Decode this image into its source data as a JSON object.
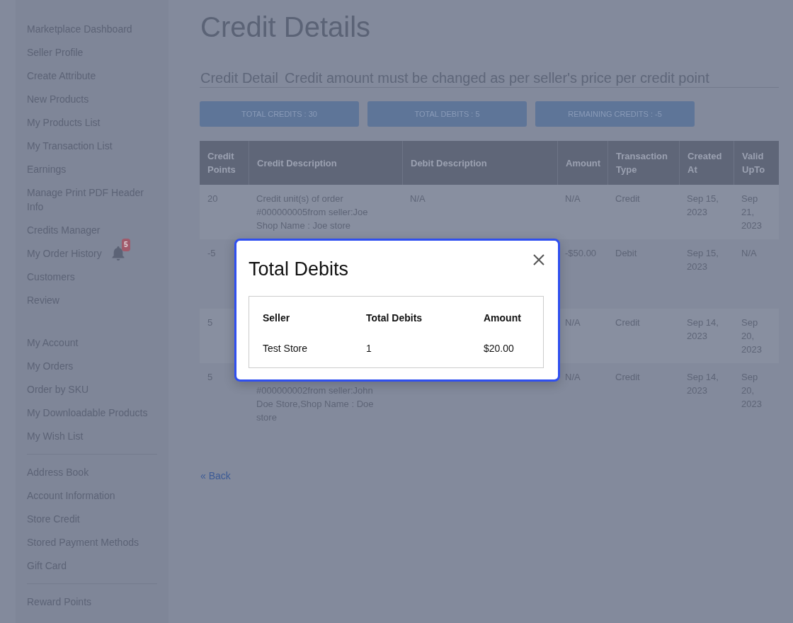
{
  "sidebar": {
    "blocks": [
      {
        "sections": [
          {
            "items": [
              {
                "label": "Marketplace Dashboard"
              },
              {
                "label": "Seller Profile"
              },
              {
                "label": "Create Attribute"
              },
              {
                "label": "New Products"
              },
              {
                "label": "My Products List"
              },
              {
                "label": "My Transaction List"
              },
              {
                "label": "Earnings"
              },
              {
                "label": "Manage Print PDF Header Info"
              },
              {
                "label": "Credits Manager"
              },
              {
                "label": "My Order History",
                "notification_count": "5"
              },
              {
                "label": "Customers"
              },
              {
                "label": "Review"
              }
            ]
          }
        ]
      },
      {
        "sections": [
          {
            "items": [
              {
                "label": "My Account"
              },
              {
                "label": "My Orders"
              },
              {
                "label": "Order by SKU"
              },
              {
                "label": "My Downloadable Products"
              },
              {
                "label": "My Wish List"
              }
            ]
          },
          {
            "items": [
              {
                "label": "Address Book"
              },
              {
                "label": "Account Information"
              },
              {
                "label": "Store Credit"
              },
              {
                "label": "Stored Payment Methods"
              },
              {
                "label": "Gift Card"
              }
            ]
          },
          {
            "items": [
              {
                "label": "Reward Points"
              }
            ]
          }
        ]
      }
    ]
  },
  "page_title": "Credit Details",
  "section": {
    "title": "Credit Detail",
    "note": "Credit amount must be changed as per seller's price per credit point"
  },
  "summary_buttons": [
    {
      "label": "TOTAL CREDITS : 30"
    },
    {
      "label": "TOTAL DEBITS : 5"
    },
    {
      "label": "REMAINING CREDITS : -5"
    }
  ],
  "table": {
    "columns": [
      "Credit Points",
      "Credit Description",
      "Debit Description",
      "Amount",
      "Transaction Type",
      "Created At",
      "Valid UpTo"
    ],
    "rows": [
      [
        "20",
        "Credit unit(s) of order #000000005from seller:Joe Shop Name : Joe store",
        "N/A",
        "N/A",
        "Credit",
        "Sep 15, 2023",
        "Sep 21, 2023"
      ],
      [
        "-5",
        null,
        null,
        "-$50.00",
        "Debit",
        "Sep 15, 2023",
        "N/A"
      ],
      [
        "5",
        null,
        null,
        "N/A",
        "Credit",
        "Sep 14, 2023",
        "Sep 20, 2023"
      ],
      [
        "5",
        {
          "text": "#000000002from seller:John Doe Store,Shop Name : Doe store",
          "cut_top": true
        },
        null,
        "N/A",
        "Credit",
        "Sep 14, 2023",
        "Sep 20, 2023"
      ]
    ]
  },
  "back_link": "« Back",
  "modal": {
    "title": "Total Debits",
    "columns": [
      "Seller",
      "Total Debits",
      "Amount"
    ],
    "rows": [
      [
        "Test Store",
        "1",
        "$20.00"
      ]
    ]
  }
}
